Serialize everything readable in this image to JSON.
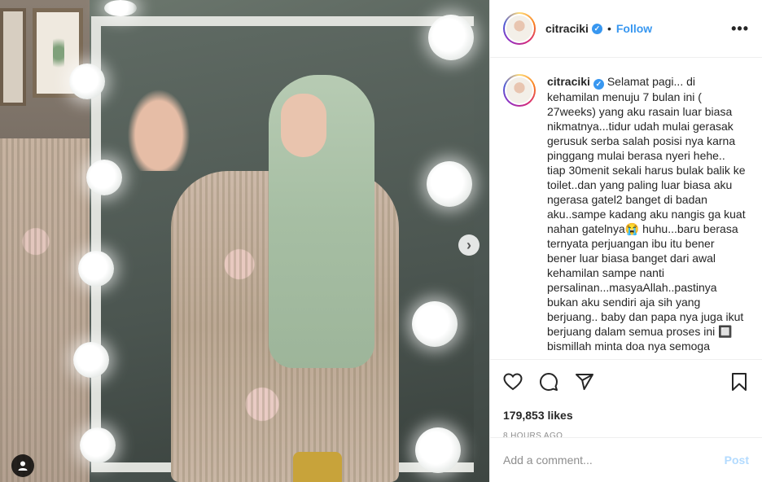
{
  "post": {
    "username": "citraciki",
    "verified_glyph": "✓",
    "separator": "•",
    "follow_label": "Follow",
    "more_glyph": "•••",
    "caption": "Selamat pagi... di kehamilan menuju 7 bulan ini ( 27weeks) yang aku rasain luar biasa nikmatnya...tidur udah mulai gerasak gerusuk serba salah posisi nya karna pinggang mulai berasa nyeri hehe.. tiap 30menit sekali harus bulak balik ke toilet..dan yang paling luar biasa aku ngerasa gatel2 banget di badan aku..sampe kadang aku nangis ga kuat nahan gatelnya😭 huhu...baru berasa ternyata perjuangan ibu itu bener bener luar biasa banget dari awal kehamilan sampe nanti persalinan...masyaAllah..pastinya bukan aku sendiri aja sih yang berjuang.. baby dan papa nya juga ikut berjuang dalam semua proses ini 🔲 bismillah minta doa nya semoga",
    "likes": "179,853 likes",
    "time": "8 HOURS AGO",
    "comment_placeholder": "Add a comment...",
    "post_label": "Post",
    "next_glyph": "›"
  },
  "icons": {
    "like": "heart-icon",
    "comment": "comment-icon",
    "share": "share-icon",
    "save": "bookmark-icon",
    "tag": "user-tag-icon",
    "next": "chevron-right-icon"
  },
  "colors": {
    "accent": "#3897f0",
    "post_disabled": "#b3dbff",
    "muted": "#8e8e8e",
    "text": "#262626"
  }
}
